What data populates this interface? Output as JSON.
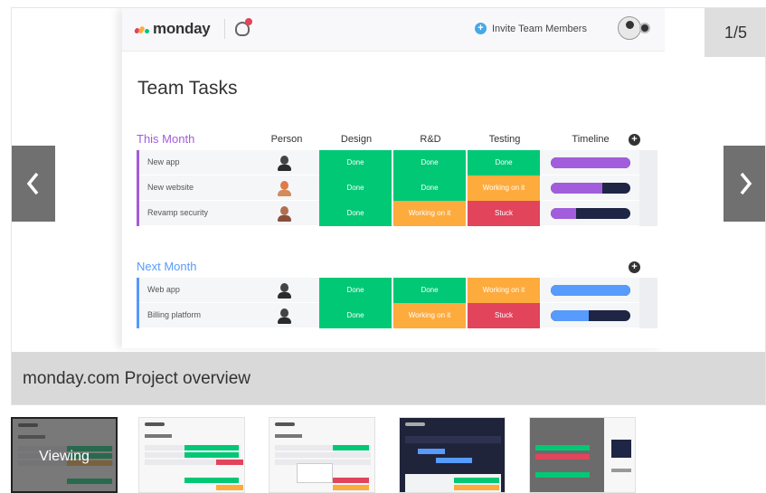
{
  "slide_app": {
    "logo_text": "monday",
    "invite_label": "Invite Team Members",
    "page_title": "Team Tasks",
    "columns": [
      "Person",
      "Design",
      "R&D",
      "Testing",
      "Timeline"
    ],
    "groups": [
      {
        "title": "This Month",
        "color": "#a25ddc",
        "rows": [
          {
            "name": "New app",
            "design": "Done",
            "rnd": "Done",
            "testing": "Done",
            "timeline_fraction": 1.0
          },
          {
            "name": "New website",
            "design": "Done",
            "rnd": "Done",
            "testing": "Working on it",
            "timeline_fraction": 0.65
          },
          {
            "name": "Revamp security",
            "design": "Done",
            "rnd": "Working on it",
            "testing": "Stuck",
            "timeline_fraction": 0.32
          }
        ]
      },
      {
        "title": "Next Month",
        "color": "#579bfc",
        "rows": [
          {
            "name": "Web app",
            "design": "Done",
            "rnd": "Done",
            "testing": "Working on it",
            "timeline_fraction": 1.0
          },
          {
            "name": "Billing platform",
            "design": "Done",
            "rnd": "Working on it",
            "testing": "Stuck",
            "timeline_fraction": 0.48
          }
        ]
      }
    ],
    "status_colors": {
      "Done": "#00c875",
      "Working on it": "#fdab3d",
      "Stuck": "#e2445c"
    }
  },
  "gallery": {
    "counter": "1/5",
    "prev_icon": "chevron-left-icon",
    "next_icon": "chevron-right-icon",
    "caption": "monday.com Project overview",
    "viewing_label": "Viewing"
  }
}
